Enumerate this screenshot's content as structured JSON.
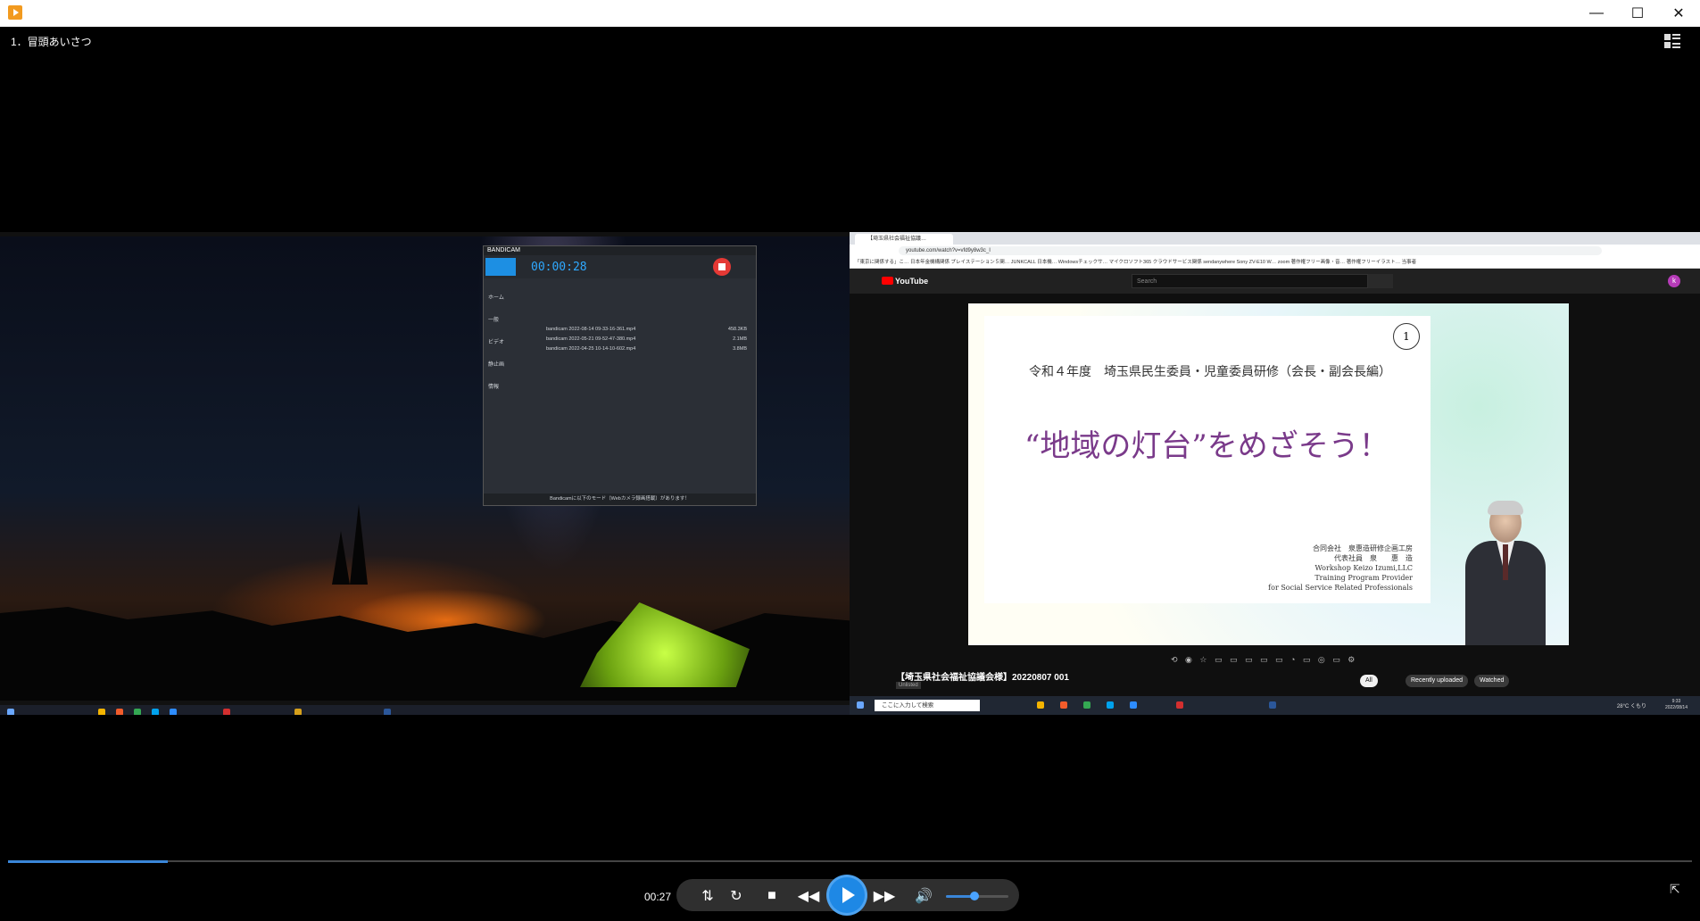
{
  "window": {
    "close_glyph": "✕",
    "maximize_glyph": "☐",
    "minimize_glyph": "—"
  },
  "video": {
    "title": "1．冒頭あいさつ",
    "progress_percent": 9.5,
    "current_time": "00:27",
    "volume_percent": 45
  },
  "bandicam": {
    "brand": "BANDICAM",
    "time": "00:00:28",
    "sidebar": [
      "ホーム",
      "一般",
      "ビデオ",
      "静止画",
      "情報"
    ],
    "files": [
      {
        "name": "bandicam 2022-08-14 09-33-16-361.mp4",
        "size": "458.3KB"
      },
      {
        "name": "bandicam 2022-05-21 09-52-47-380.mp4",
        "size": "2.1MB"
      },
      {
        "name": "bandicam 2022-04-25 10-14-10-602.mp4",
        "size": "3.8MB"
      }
    ],
    "footer": "Bandicamに以下のモード（Webカメラ録画搭載）があります！"
  },
  "browser": {
    "tab_title": "【埼玉県社会福祉協議…",
    "url": "youtube.com/watch?v=vfd9y8w3c_I",
    "bookmarks": "「東京に関係する」こ…  日本年金機構関係  プレイステーション５関…  JUNKCALL 日本機…  Windowsチェックサ…  マイクロソフト365  クラウドサービス関係  sendanywhere  Sony ZV-E10 W…  zoom  著作権フリー画像・音…  著作権フリーイラスト…  当事者"
  },
  "youtube": {
    "logo": "YouTube",
    "search_placeholder": "Search",
    "avatar": "k",
    "video_title": "【埼玉県社会福祉協議会様】20220807 001",
    "unlisted": "Unlisted",
    "chips": [
      "All",
      "Recently uploaded",
      "Watched"
    ]
  },
  "slide": {
    "number": "1",
    "subtitle": "令和４年度　埼玉県民生委員・児童委員研修（会長・副会長編）",
    "title": "“地域の灯台”をめざそう！",
    "org_lines": [
      "合同会社　泉惠造研修企画工房",
      "代表社員　泉　　惠　造",
      "Workshop Keizo Izumi,LLC",
      "Training Program Provider",
      "for Social Service Related Professionals"
    ]
  },
  "taskbar_right": {
    "search_placeholder": "ここに入力して検索",
    "tray": "28°C くもり",
    "clock_time": "9:33",
    "clock_date": "2022/08/14"
  },
  "colors": {
    "accent": "#1e88e5",
    "record": "#e53935",
    "slide_title": "#7a3a8a"
  }
}
